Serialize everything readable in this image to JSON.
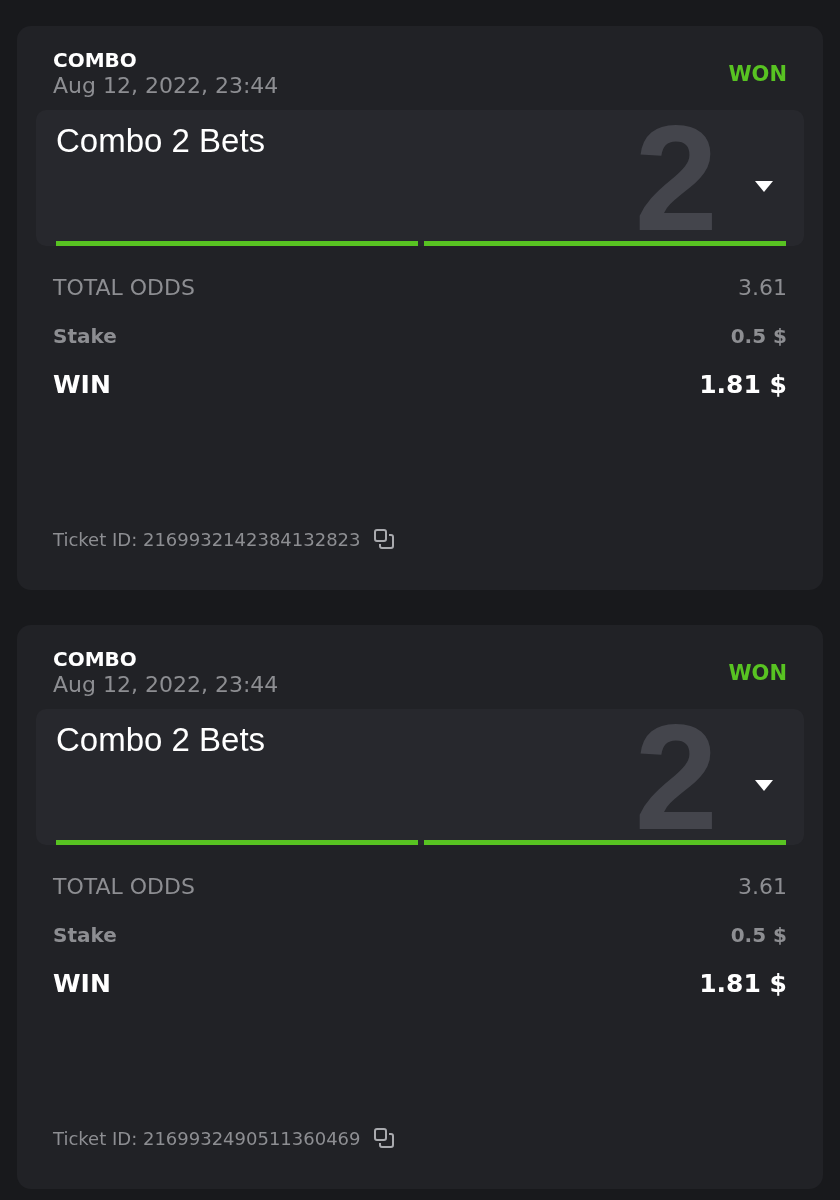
{
  "tickets": [
    {
      "type": "COMBO",
      "date": "Aug 12, 2022, 23:44",
      "status": {
        "text": "WON",
        "kind": "won"
      },
      "bet": {
        "title": "Combo 2 Bets",
        "count": "2",
        "expanded": false,
        "legs": [
          {
            "won": true
          },
          {
            "won": true
          }
        ]
      },
      "total_odds_label": "TOTAL ODDS",
      "total_odds": "3.61",
      "stake_label": "Stake",
      "stake": "0.5 $",
      "win_label": "WIN",
      "win": "1.81 $",
      "ticket_id": "Ticket ID: 2169932142384132823"
    },
    {
      "type": "COMBO",
      "date": "Aug 12, 2022, 23:44",
      "status": {
        "text": "WON",
        "kind": "won"
      },
      "bet": {
        "title": "Combo 2 Bets",
        "count": "2",
        "expanded": false,
        "legs": [
          {
            "won": true
          },
          {
            "won": true
          }
        ]
      },
      "total_odds_label": "TOTAL ODDS",
      "total_odds": "3.61",
      "stake_label": "Stake",
      "stake": "0.5 $",
      "win_label": "WIN",
      "win": "1.81 $",
      "ticket_id": "Ticket ID: 2169932490511360469"
    }
  ]
}
